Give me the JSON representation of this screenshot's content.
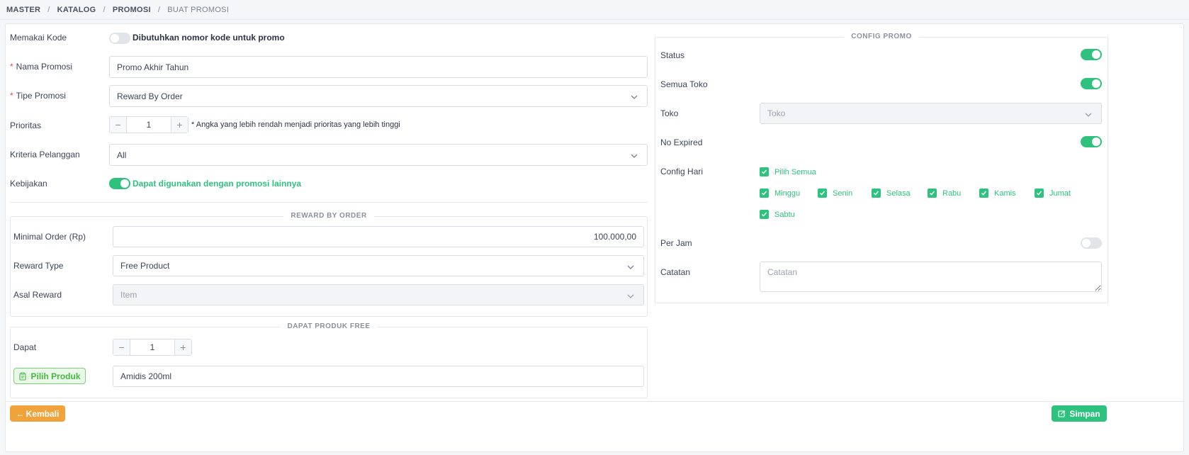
{
  "breadcrumb": {
    "items": [
      "MASTER",
      "KATALOG",
      "PROMOSI"
    ],
    "current": "BUAT PROMOSI"
  },
  "form": {
    "memakai_kode": {
      "label": "Memakai Kode",
      "toggle_text": "Dibutuhkan nomor kode untuk promo",
      "on": false
    },
    "nama_promosi": {
      "label": "Nama Promosi",
      "value": "Promo Akhir Tahun"
    },
    "tipe_promosi": {
      "label": "Tipe Promosi",
      "value": "Reward By Order"
    },
    "prioritas": {
      "label": "Prioritas",
      "value": "1",
      "hint": "* Angka yang lebih rendah menjadi prioritas yang lebih tinggi"
    },
    "kriteria_pelanggan": {
      "label": "Kriteria Pelanggan",
      "value": "All"
    },
    "kebijakan": {
      "label": "Kebijakan",
      "toggle_text": "Dapat digunakan dengan promosi lainnya",
      "on": true
    }
  },
  "reward_by_order": {
    "title": "REWARD BY ORDER",
    "minimal_order": {
      "label": "Minimal Order (Rp)",
      "value": "100.000,00"
    },
    "reward_type": {
      "label": "Reward Type",
      "value": "Free Product"
    },
    "asal_reward": {
      "label": "Asal Reward",
      "value": "Item"
    }
  },
  "dapat_produk_free": {
    "title": "DAPAT PRODUK FREE",
    "dapat": {
      "label": "Dapat",
      "value": "1"
    },
    "pilih_produk_label": "Pilih Produk",
    "produk_value": "Amidis 200ml"
  },
  "config_promo": {
    "title": "CONFIG PROMO",
    "status": {
      "label": "Status",
      "on": true
    },
    "semua_toko": {
      "label": "Semua Toko",
      "on": true
    },
    "toko": {
      "label": "Toko",
      "placeholder": "Toko"
    },
    "no_expired": {
      "label": "No Expired",
      "on": true
    },
    "config_hari": {
      "label": "Config Hari",
      "pilih_semua": "Pilih Semua",
      "days": [
        "Minggu",
        "Senin",
        "Selasa",
        "Rabu",
        "Kamis",
        "Jumat",
        "Sabtu"
      ]
    },
    "per_jam": {
      "label": "Per Jam",
      "on": false
    },
    "catatan": {
      "label": "Catatan",
      "placeholder": "Catatan"
    }
  },
  "actions": {
    "back_label": "Kembali",
    "save_label": "Simpan"
  },
  "colors": {
    "accent_green": "#2ec27e",
    "orange": "#f0a23b",
    "required_red": "#e84a4a"
  }
}
